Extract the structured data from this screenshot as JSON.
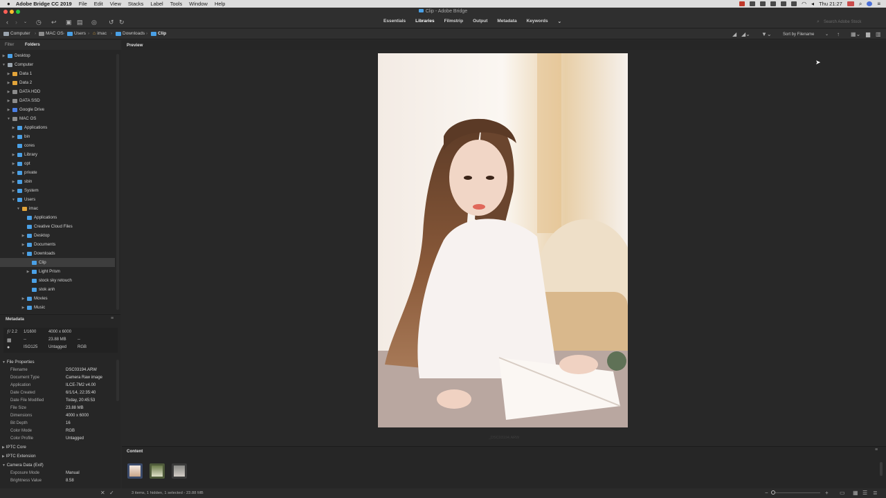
{
  "menubar": {
    "app_name": "Adobe Bridge CC 2019",
    "items": [
      "File",
      "Edit",
      "View",
      "Stacks",
      "Label",
      "Tools",
      "Window",
      "Help"
    ],
    "clock": "Thu 21:27"
  },
  "window": {
    "title": "Clip - Adobe Bridge"
  },
  "toolbar": {
    "workspaces": [
      "Essentials",
      "Libraries",
      "Filmstrip",
      "Output",
      "Metadata",
      "Keywords"
    ],
    "active_workspace": "Libraries",
    "search_placeholder": "Search Adobe Stock"
  },
  "breadcrumb": [
    "Computer",
    "MAC OS",
    "Users",
    "imac",
    "Downloads",
    "Clip"
  ],
  "sort_label": "Sort by Filename",
  "left_tabs": {
    "filter": "Filter",
    "folders": "Folders"
  },
  "folders": [
    {
      "label": "Desktop",
      "depth": 0,
      "twisty": "▶",
      "icon": "folder"
    },
    {
      "label": "Computer",
      "depth": 0,
      "twisty": "▼",
      "icon": "computer"
    },
    {
      "label": "Data 1",
      "depth": 1,
      "twisty": "▶",
      "icon": "drive-orange"
    },
    {
      "label": "Data 2",
      "depth": 1,
      "twisty": "▶",
      "icon": "drive-orange"
    },
    {
      "label": "DATA HDD",
      "depth": 1,
      "twisty": "▶",
      "icon": "drive"
    },
    {
      "label": "DATA SSD",
      "depth": 1,
      "twisty": "▶",
      "icon": "drive"
    },
    {
      "label": "Google Drive",
      "depth": 1,
      "twisty": "▶",
      "icon": "drive-blue"
    },
    {
      "label": "MAC OS",
      "depth": 1,
      "twisty": "▼",
      "icon": "drive"
    },
    {
      "label": "Applications",
      "depth": 2,
      "twisty": "▶",
      "icon": "folder"
    },
    {
      "label": "bin",
      "depth": 2,
      "twisty": "▶",
      "icon": "folder"
    },
    {
      "label": "cores",
      "depth": 2,
      "twisty": "",
      "icon": "folder"
    },
    {
      "label": "Library",
      "depth": 2,
      "twisty": "▶",
      "icon": "folder"
    },
    {
      "label": "opt",
      "depth": 2,
      "twisty": "▶",
      "icon": "folder"
    },
    {
      "label": "private",
      "depth": 2,
      "twisty": "▶",
      "icon": "folder"
    },
    {
      "label": "sbin",
      "depth": 2,
      "twisty": "▶",
      "icon": "folder"
    },
    {
      "label": "System",
      "depth": 2,
      "twisty": "▶",
      "icon": "folder"
    },
    {
      "label": "Users",
      "depth": 2,
      "twisty": "▼",
      "icon": "folder"
    },
    {
      "label": "imac",
      "depth": 3,
      "twisty": "▼",
      "icon": "home"
    },
    {
      "label": "Applications",
      "depth": 4,
      "twisty": "",
      "icon": "folder"
    },
    {
      "label": "Creative Cloud Files",
      "depth": 4,
      "twisty": "",
      "icon": "folder"
    },
    {
      "label": "Desktop",
      "depth": 4,
      "twisty": "▶",
      "icon": "folder"
    },
    {
      "label": "Documents",
      "depth": 4,
      "twisty": "▶",
      "icon": "folder"
    },
    {
      "label": "Downloads",
      "depth": 4,
      "twisty": "▼",
      "icon": "folder"
    },
    {
      "label": "Clip",
      "depth": 5,
      "twisty": "",
      "icon": "folder",
      "selected": true
    },
    {
      "label": "Light Prism",
      "depth": 5,
      "twisty": "▶",
      "icon": "folder"
    },
    {
      "label": "stock sky retouch",
      "depth": 5,
      "twisty": "",
      "icon": "folder"
    },
    {
      "label": "stok anh",
      "depth": 5,
      "twisty": "",
      "icon": "folder"
    },
    {
      "label": "Movies",
      "depth": 4,
      "twisty": "▶",
      "icon": "folder"
    },
    {
      "label": "Music",
      "depth": 4,
      "twisty": "▶",
      "icon": "folder"
    }
  ],
  "metadata": {
    "title": "Metadata",
    "summary": {
      "aperture": "2.2",
      "shutter": "1/1600",
      "dimensions": "4000 x 6000",
      "wb": "--",
      "size": "23.88 MB",
      "size_extra": "--",
      "iso": "ISO125",
      "tag": "Untagged",
      "mode": "RGB"
    },
    "file_properties_title": "File Properties",
    "file_properties": [
      {
        "key": "Filename",
        "value": "DSC03194.ARW"
      },
      {
        "key": "Document Type",
        "value": "Camera Raw image"
      },
      {
        "key": "Application",
        "value": "ILCE-7M2 v4.00"
      },
      {
        "key": "Date Created",
        "value": "6/1/14, 22:35:40"
      },
      {
        "key": "Date File Modified",
        "value": "Today, 20:45:53"
      },
      {
        "key": "File Size",
        "value": "23.88 MB"
      },
      {
        "key": "Dimensions",
        "value": "4000 x 6000"
      },
      {
        "key": "Bit Depth",
        "value": "16"
      },
      {
        "key": "Color Mode",
        "value": "RGB"
      },
      {
        "key": "Color Profile",
        "value": "Untagged"
      }
    ],
    "iptc_core": "IPTC Core",
    "iptc_extension": "IPTC Extension",
    "camera_data_title": "Camera Data (Exif)",
    "camera_data": [
      {
        "key": "Exposure Mode",
        "value": "Manual"
      },
      {
        "key": "Brightness Value",
        "value": "8.58"
      }
    ]
  },
  "preview": {
    "tab_label": "Preview",
    "caption": "_DSC03194.ARW"
  },
  "content": {
    "title": "Content",
    "thumb_count": 3,
    "selected_index": 0
  },
  "status": {
    "text": "3 items, 1 hidden, 1 selected - 23.88 MB"
  },
  "colors": {
    "accent": "#4aa0e6",
    "panel": "#262626",
    "bg": "#282828"
  }
}
